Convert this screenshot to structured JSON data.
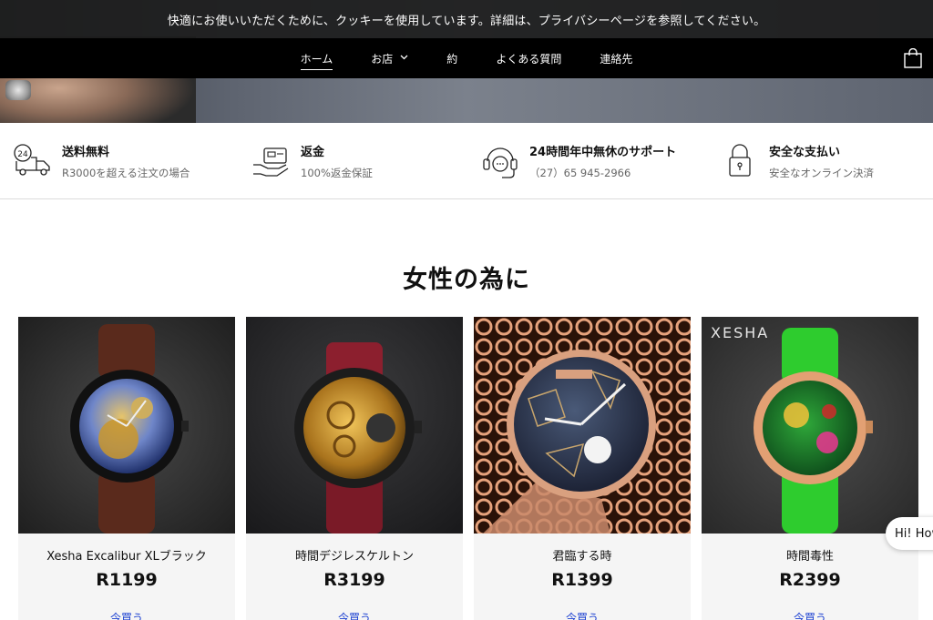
{
  "cookie": {
    "message": "快適にお使いいただくために、クッキーを使用しています。詳細は、プライバシーページを参照してください。"
  },
  "nav": {
    "items": [
      {
        "label": "ホーム",
        "active": true
      },
      {
        "label": "お店",
        "has_dropdown": true
      },
      {
        "label": "約"
      },
      {
        "label": "よくある質問"
      },
      {
        "label": "連絡先"
      }
    ],
    "cart_icon": "shopping-bag-icon"
  },
  "features": [
    {
      "icon": "delivery-truck-24-icon",
      "title": "送料無料",
      "subtitle": "R3000を超える注文の場合"
    },
    {
      "icon": "hand-card-refund-icon",
      "title": "返金",
      "subtitle": "100%返金保証"
    },
    {
      "icon": "headset-support-icon",
      "title": "24時間年中無休のサポート",
      "subtitle": "（27）65 945-2966"
    },
    {
      "icon": "padlock-icon",
      "title": "安全な支払い",
      "subtitle": "安全なオンライン決済"
    }
  ],
  "section": {
    "title": "女性の為に"
  },
  "products": [
    {
      "name": "Xesha Excalibur XLブラック",
      "price": "R1199",
      "buy_label": "今買う",
      "image_icon": "skeleton-watch-brown-strap-icon"
    },
    {
      "name": "時間デジレスケルトン",
      "price": "R3199",
      "buy_label": "今買う",
      "image_icon": "gold-skeleton-watch-red-strap-icon"
    },
    {
      "name": "君臨する時",
      "price": "R1399",
      "buy_label": "今買う",
      "image_icon": "patterned-dial-mesh-watch-icon"
    },
    {
      "name": "時間毒性",
      "price": "R2399",
      "buy_label": "今買う",
      "image_icon": "green-skeleton-watch-icon",
      "brand_mark": "XESHA"
    }
  ],
  "chat": {
    "label": "Hi! How"
  }
}
